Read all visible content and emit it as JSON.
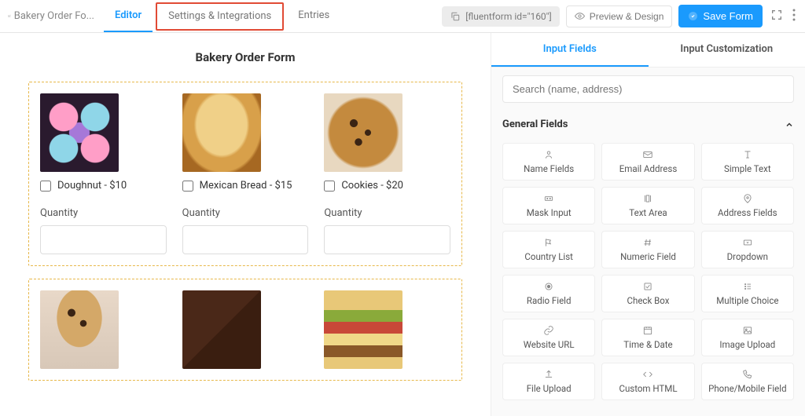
{
  "topbar": {
    "form_name": "Bakery Order Fo...",
    "tabs": [
      "Editor",
      "Settings & Integrations",
      "Entries"
    ],
    "shortcode": "[fluentform id=\"160\"]",
    "preview_label": "Preview & Design",
    "save_label": "Save Form"
  },
  "form": {
    "title": "Bakery Order Form",
    "quantity_label": "Quantity",
    "products_row1": [
      {
        "label": "Doughnut - $10"
      },
      {
        "label": "Mexican Bread - $15"
      },
      {
        "label": "Cookies - $20"
      }
    ]
  },
  "sidebar": {
    "tabs": [
      "Input Fields",
      "Input Customization"
    ],
    "search_placeholder": "Search (name, address)",
    "section_title": "General Fields",
    "fields": [
      "Name Fields",
      "Email Address",
      "Simple Text",
      "Mask Input",
      "Text Area",
      "Address Fields",
      "Country List",
      "Numeric Field",
      "Dropdown",
      "Radio Field",
      "Check Box",
      "Multiple Choice",
      "Website URL",
      "Time & Date",
      "Image Upload",
      "File Upload",
      "Custom HTML",
      "Phone/Mobile Field"
    ]
  }
}
